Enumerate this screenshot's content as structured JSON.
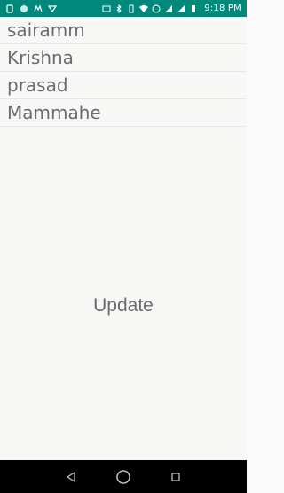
{
  "status_bar": {
    "time": "9:18 PM",
    "icons_left": [
      "sim-icon",
      "circle-app-icon",
      "mail-app-icon",
      "sync-app-icon"
    ],
    "icons_right": [
      "cast-icon",
      "bluetooth-icon",
      "vibrate-icon",
      "wifi-icon",
      "volte-icon",
      "signal-icon",
      "signal-icon-2",
      "battery-icon"
    ]
  },
  "list": {
    "items": [
      "sairamm",
      "Krishna",
      "prasad",
      "Mammahe"
    ]
  },
  "update_button": {
    "label": "Update"
  },
  "nav_bar": {
    "buttons": [
      "back-icon",
      "home-icon",
      "recents-icon"
    ]
  },
  "colors": {
    "status_bar": "#00897b",
    "nav_bar": "#000000",
    "text": "#6b6b6b"
  }
}
